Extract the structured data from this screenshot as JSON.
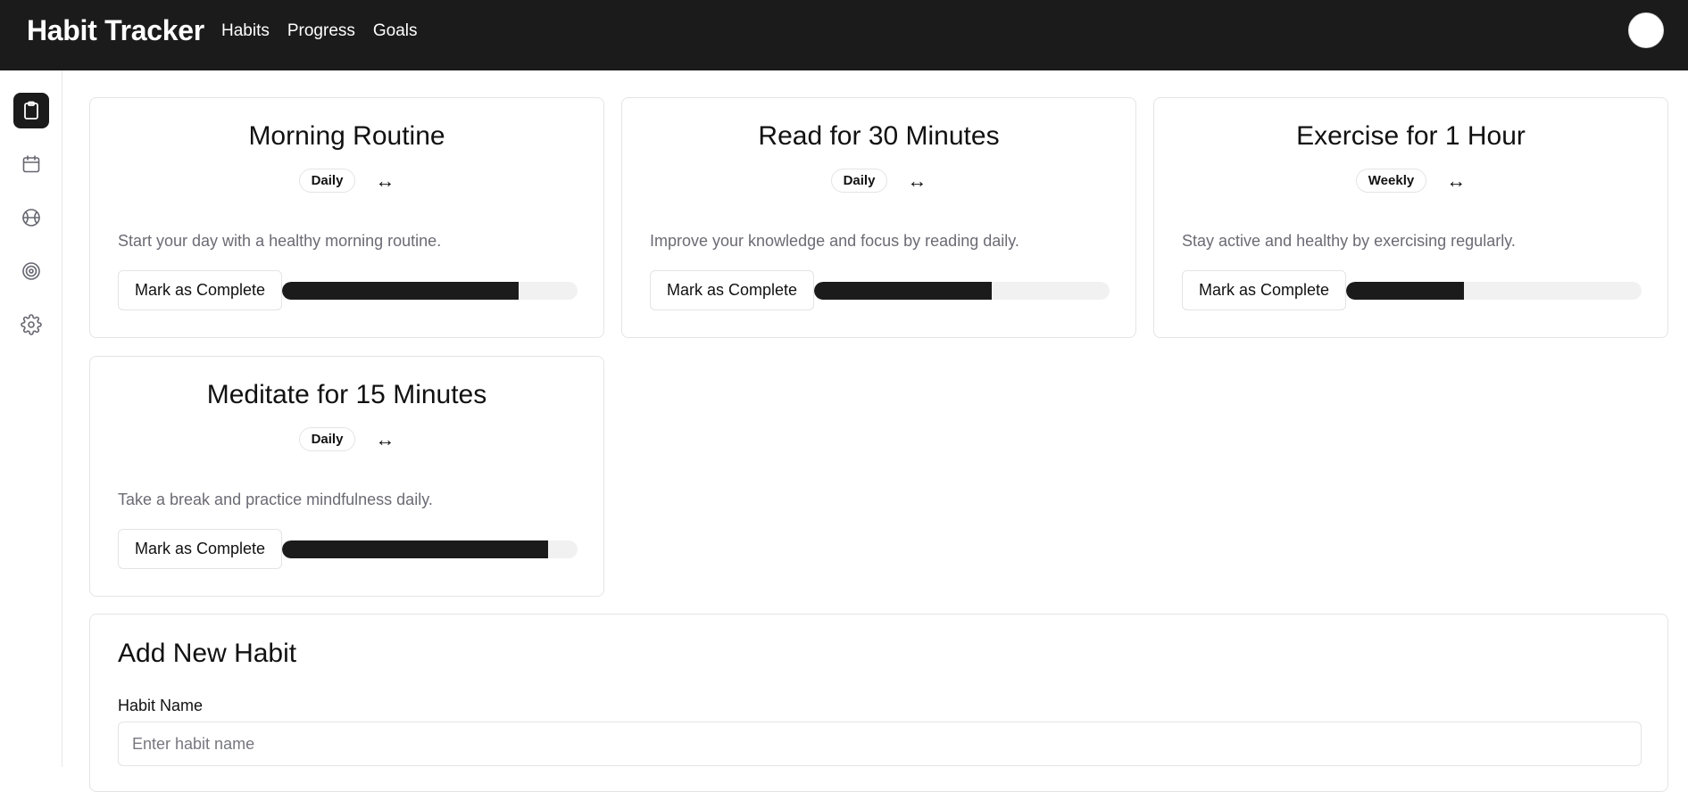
{
  "header": {
    "brand": "Habit Tracker",
    "nav": [
      "Habits",
      "Progress",
      "Goals"
    ]
  },
  "sidebar": {
    "items": [
      {
        "icon": "clipboard-icon",
        "active": true
      },
      {
        "icon": "calendar-icon",
        "active": false
      },
      {
        "icon": "basketball-icon",
        "active": false
      },
      {
        "icon": "target-icon",
        "active": false
      },
      {
        "icon": "gear-icon",
        "active": false
      }
    ]
  },
  "habits": [
    {
      "title": "Morning Routine",
      "frequency": "Daily",
      "description": "Start your day with a healthy morning routine.",
      "button": "Mark as Complete",
      "progress": 0.8
    },
    {
      "title": "Read for 30 Minutes",
      "frequency": "Daily",
      "description": "Improve your knowledge and focus by reading daily.",
      "button": "Mark as Complete",
      "progress": 0.6
    },
    {
      "title": "Exercise for 1 Hour",
      "frequency": "Weekly",
      "description": "Stay active and healthy by exercising regularly.",
      "button": "Mark as Complete",
      "progress": 0.4
    },
    {
      "title": "Meditate for 15 Minutes",
      "frequency": "Daily",
      "description": "Take a break and practice mindfulness daily.",
      "button": "Mark as Complete",
      "progress": 0.9
    }
  ],
  "swap_symbol": "↔",
  "colors": {
    "header_bg": "#1b1b1c",
    "accent": "#1b1b1c",
    "track": "#f1f1f2"
  },
  "form": {
    "title": "Add New Habit",
    "name_label": "Habit Name",
    "name_placeholder": "Enter habit name",
    "name_value": ""
  }
}
